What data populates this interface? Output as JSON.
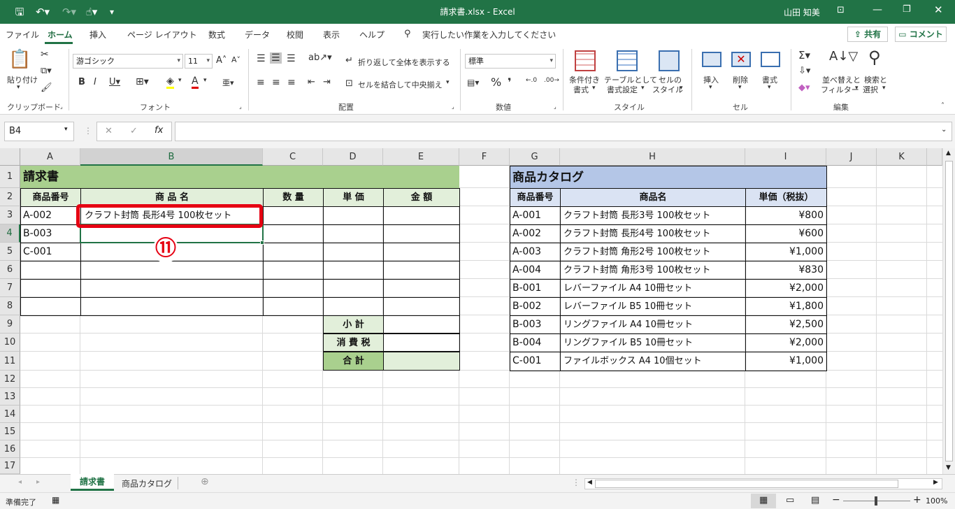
{
  "window": {
    "title": "請求書.xlsx - Excel",
    "user": "山田 知美"
  },
  "ribbon_tabs": [
    "ファイル",
    "ホーム",
    "挿入",
    "ページ レイアウト",
    "数式",
    "データ",
    "校閲",
    "表示",
    "ヘルプ"
  ],
  "tell_me": "実行したい作業を入力してください",
  "share": "共有",
  "comment": "コメント",
  "ribbon": {
    "paste": "貼り付け",
    "clipboard": "クリップボード",
    "font_group": "フォント",
    "align_group": "配置",
    "number_group": "数値",
    "style_group": "スタイル",
    "cells_group": "セル",
    "edit_group": "編集",
    "font_name": "游ゴシック",
    "font_size": "11",
    "wrap": "折り返して全体を表示する",
    "merge": "セルを結合して中央揃え",
    "number_format": "標準",
    "cond_format1": "条件付き",
    "cond_format2": "書式",
    "table_format1": "テーブルとして",
    "table_format2": "書式設定",
    "cell_style1": "セルの",
    "cell_style2": "スタイル",
    "insert": "挿入",
    "delete": "削除",
    "format": "書式",
    "sort1": "並べ替えと",
    "sort2": "フィルター",
    "find1": "検索と",
    "find2": "選択"
  },
  "namebox": "B4",
  "columns": [
    "A",
    "B",
    "C",
    "D",
    "E",
    "F",
    "G",
    "H",
    "I",
    "J",
    "K"
  ],
  "rows": [
    "1",
    "2",
    "3",
    "4",
    "5",
    "6",
    "7",
    "8",
    "9",
    "10",
    "11",
    "12",
    "13",
    "14",
    "15",
    "16",
    "17"
  ],
  "invoice": {
    "title": "請求書",
    "headers": [
      "商品番号",
      "商 品 名",
      "数 量",
      "単 価",
      "金 額"
    ],
    "codes": [
      "A-002",
      "B-003",
      "C-001"
    ],
    "b3": "クラフト封筒 長形4号 100枚セット",
    "subtotal": "小 計",
    "tax": "消 費 税",
    "total": "合 計"
  },
  "catalog": {
    "title": "商品カタログ",
    "headers": [
      "商品番号",
      "商品名",
      "単価（税抜）"
    ],
    "rows": [
      [
        "A-001",
        "クラフト封筒 長形3号 100枚セット",
        "¥800"
      ],
      [
        "A-002",
        "クラフト封筒 長形4号 100枚セット",
        "¥600"
      ],
      [
        "A-003",
        "クラフト封筒 角形2号 100枚セット",
        "¥1,000"
      ],
      [
        "A-004",
        "クラフト封筒 角形3号 100枚セット",
        "¥830"
      ],
      [
        "B-001",
        "レバーファイル A4 10冊セット",
        "¥2,000"
      ],
      [
        "B-002",
        "レバーファイル B5 10冊セット",
        "¥1,800"
      ],
      [
        "B-003",
        "リングファイル A4 10冊セット",
        "¥2,500"
      ],
      [
        "B-004",
        "リングファイル B5 10冊セット",
        "¥2,000"
      ],
      [
        "C-001",
        "ファイルボックス A4 10個セット",
        "¥1,000"
      ]
    ]
  },
  "callout": "⑪",
  "sheet_tabs": [
    "請求書",
    "商品カタログ"
  ],
  "status": {
    "ready": "準備完了",
    "zoom": "100%"
  },
  "colors": {
    "excel_green": "#217346",
    "invoice_header": "#a9d08e",
    "invoice_sub": "#e2efda",
    "catalog_header": "#b4c6e7",
    "callout": "#e60012"
  }
}
